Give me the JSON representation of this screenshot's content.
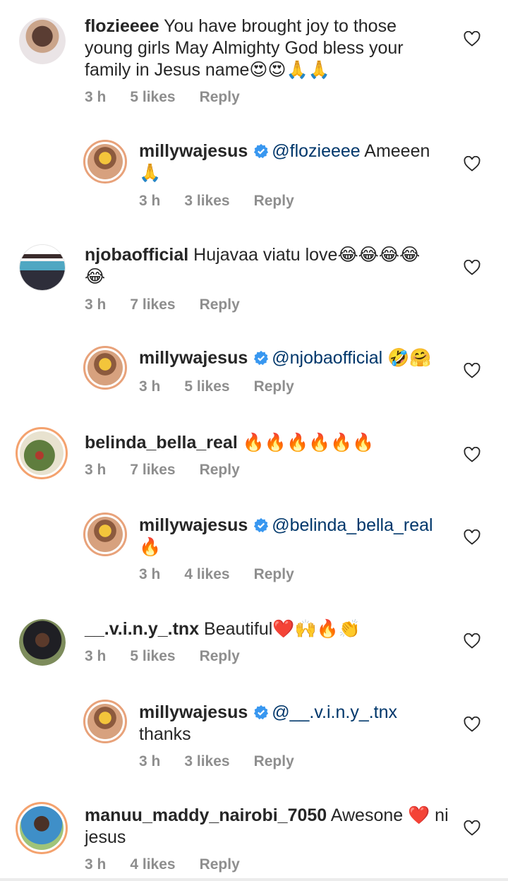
{
  "colors": {
    "text": "#262626",
    "meta": "#8e8e8e",
    "mention": "#00376b",
    "verified": "#3897f0",
    "ring": "#f0a56a"
  },
  "comments": [
    {
      "user": "flozieeee",
      "text": " You have brought joy to those young girls May Almighty God bless your family in Jesus name😍😍🙏🙏",
      "time": "3 h",
      "likes": "5 likes",
      "reply": "Reply"
    },
    {
      "user": "millywajesus",
      "mention": "@flozieeee",
      "text": " Ameeen 🙏",
      "time": "3 h",
      "likes": "3 likes",
      "reply": "Reply"
    },
    {
      "user": "njobaofficial",
      "text": " Hujavaa viatu love😂😂😂😂😂",
      "time": "3 h",
      "likes": "7 likes",
      "reply": "Reply"
    },
    {
      "user": "millywajesus",
      "mention": "@njobaofficial",
      "text": " 🤣🤗",
      "time": "3 h",
      "likes": "5 likes",
      "reply": "Reply"
    },
    {
      "user": "belinda_bella_real",
      "text": " 🔥🔥🔥🔥🔥🔥",
      "time": "3 h",
      "likes": "7 likes",
      "reply": "Reply"
    },
    {
      "user": "millywajesus",
      "mention": "@belinda_bella_real",
      "text": " 🔥",
      "time": "3 h",
      "likes": "4 likes",
      "reply": "Reply"
    },
    {
      "user": "__.v.i.n.y_.tnx",
      "text": " Beautiful❤️🙌🔥👏",
      "time": "3 h",
      "likes": "5 likes",
      "reply": "Reply"
    },
    {
      "user": "millywajesus",
      "mention": "@__.v.i.n.y_.tnx",
      "text": " thanks",
      "time": "3 h",
      "likes": "3 likes",
      "reply": "Reply"
    },
    {
      "user": "manuu_maddy_nairobi_7050",
      "text": " Awesone ❤️ ni jesus",
      "time": "3 h",
      "likes": "4 likes",
      "reply": "Reply"
    }
  ]
}
